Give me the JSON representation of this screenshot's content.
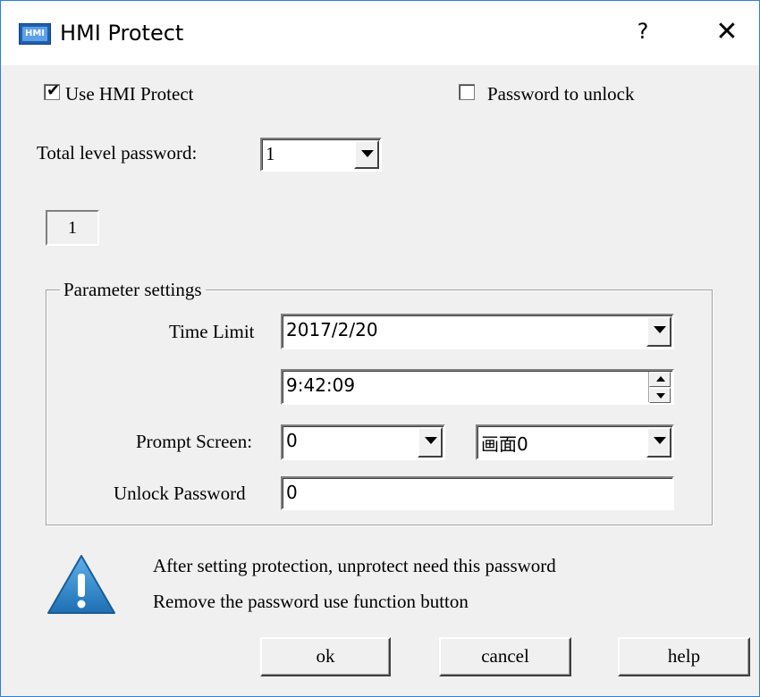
{
  "window": {
    "title": "HMI Protect",
    "app_icon_text": "HMI",
    "help_glyph": "?",
    "close_glyph": "✕"
  },
  "options": {
    "use_hmi_protect": {
      "label": "Use HMI Protect",
      "checked": true,
      "check_glyph": "✔"
    },
    "password_to_unlock": {
      "label": "Password to unlock",
      "checked": false
    }
  },
  "total_level": {
    "label": "Total level password:",
    "value": "1"
  },
  "level_tab": {
    "label": "1"
  },
  "parameters": {
    "group_title": "Parameter settings",
    "time_limit": {
      "label": "Time Limit",
      "date": "2017/2/20",
      "time": "9:42:09"
    },
    "prompt_screen": {
      "label": "Prompt Screen:",
      "number": "0",
      "screen_name": "画面0"
    },
    "unlock_password": {
      "label": "Unlock Password",
      "value": "0"
    }
  },
  "notice": {
    "line1": "After setting protection, unprotect need this password",
    "line2": "Remove the password use function button",
    "icon": "warning-icon"
  },
  "buttons": {
    "ok": "ok",
    "cancel": "cancel",
    "help": "help"
  },
  "colors": {
    "window_border": "#2f7ed8",
    "dialog_bg": "#f0f0f0",
    "warning_blue": "#2b7fc4"
  }
}
